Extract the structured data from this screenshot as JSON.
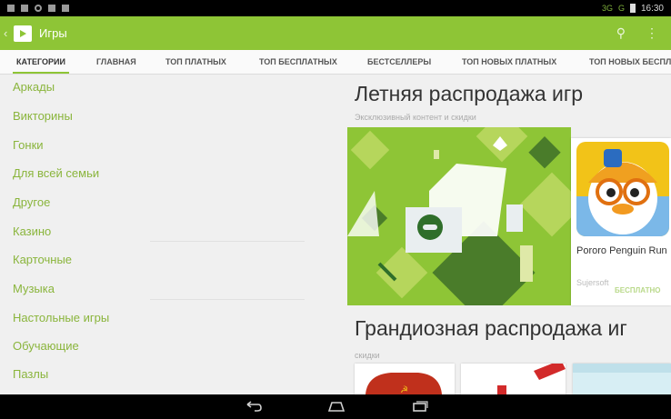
{
  "status_bar": {
    "network": "3G",
    "network_secondary": "G",
    "time": "16:30"
  },
  "action_bar": {
    "back_icon": "chevron-left-icon",
    "app_icon": "play-store-icon",
    "title": "Игры",
    "search_icon": "search-icon",
    "overflow_icon": "overflow-menu-icon",
    "search_glyph": "⚲",
    "overflow_glyph": "⋮",
    "color": "#8ec536"
  },
  "tabs": [
    {
      "label": "КАТЕГОРИИ",
      "active": true
    },
    {
      "label": "ГЛАВНАЯ",
      "active": false
    },
    {
      "label": "ТОП ПЛАТНЫХ",
      "active": false
    },
    {
      "label": "ТОП БЕСПЛАТНЫХ",
      "active": false
    },
    {
      "label": "БЕСТСЕЛЛЕРЫ",
      "active": false
    },
    {
      "label": "ТОП НОВЫХ ПЛАТНЫХ",
      "active": false
    },
    {
      "label": "ТОП НОВЫХ БЕСПЛ",
      "active": false
    }
  ],
  "categories": [
    "Аркады",
    "Викторины",
    "Гонки",
    "Для всей семьи",
    "Другое",
    "Казино",
    "Карточные",
    "Музыка",
    "Настольные игры",
    "Обучающие",
    "Пазлы"
  ],
  "promo_summer": {
    "title": "Летняя распродажа игр",
    "subtitle": "Эксклюзивный контент и скидки"
  },
  "featured_app": {
    "name": "Pororo Penguin Run",
    "developer": "Sujersoft",
    "price": "БЕСПЛАТНО"
  },
  "promo_grand": {
    "title": "Грандиозная распродажа иг",
    "subtitle": "скидки"
  },
  "navigation": {
    "back_icon": "back-arrow-icon",
    "home_icon": "home-icon",
    "recents_icon": "recent-apps-icon"
  },
  "colors": {
    "accent": "#8ec536",
    "category_text": "#8ab53c"
  }
}
